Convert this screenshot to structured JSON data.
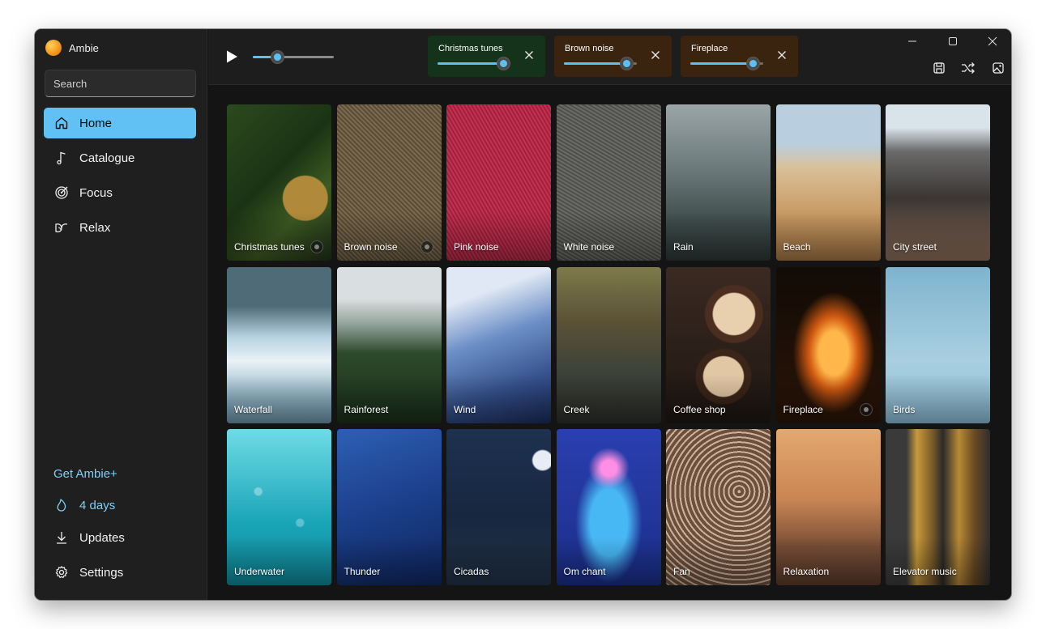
{
  "app": {
    "title": "Ambie"
  },
  "search": {
    "placeholder": "Search"
  },
  "nav": [
    {
      "label": "Home",
      "icon": "home-icon",
      "active": true
    },
    {
      "label": "Catalogue",
      "icon": "music-note-icon",
      "active": false
    },
    {
      "label": "Focus",
      "icon": "target-icon",
      "active": false
    },
    {
      "label": "Relax",
      "icon": "relax-icon",
      "active": false
    }
  ],
  "bottom": {
    "get_plus": "Get Ambie+",
    "streak": "4 days",
    "updates": "Updates",
    "settings": "Settings"
  },
  "player": {
    "master_volume": 0.3
  },
  "active_sounds": [
    {
      "label": "Christmas tunes",
      "volume": 0.9,
      "color": "#15321a"
    },
    {
      "label": "Brown noise",
      "volume": 0.85,
      "color": "#3a2410"
    },
    {
      "label": "Fireplace",
      "volume": 0.85,
      "color": "#3a2410"
    }
  ],
  "toolbar": [
    "save-icon",
    "shuffle-icon",
    "image-icon",
    "share-icon"
  ],
  "colors": {
    "accent": "#61c1f4",
    "sidebar": "#1f1f1f",
    "background": "#141414"
  },
  "sounds": [
    {
      "label": "Christmas tunes",
      "playing": true
    },
    {
      "label": "Brown noise",
      "playing": true
    },
    {
      "label": "Pink noise",
      "playing": false
    },
    {
      "label": "White noise",
      "playing": false
    },
    {
      "label": "Rain",
      "playing": false
    },
    {
      "label": "Beach",
      "playing": false
    },
    {
      "label": "City street",
      "playing": false
    },
    {
      "label": "Waterfall",
      "playing": false
    },
    {
      "label": "Rainforest",
      "playing": false
    },
    {
      "label": "Wind",
      "playing": false
    },
    {
      "label": "Creek",
      "playing": false
    },
    {
      "label": "Coffee shop",
      "playing": false
    },
    {
      "label": "Fireplace",
      "playing": true
    },
    {
      "label": "Birds",
      "playing": false
    },
    {
      "label": "Underwater",
      "playing": false
    },
    {
      "label": "Thunder",
      "playing": false
    },
    {
      "label": "Cicadas",
      "playing": false
    },
    {
      "label": "Om chant",
      "playing": false
    },
    {
      "label": "Fan",
      "playing": false
    },
    {
      "label": "Relaxation",
      "playing": false
    },
    {
      "label": "Elevator music",
      "playing": false
    }
  ]
}
